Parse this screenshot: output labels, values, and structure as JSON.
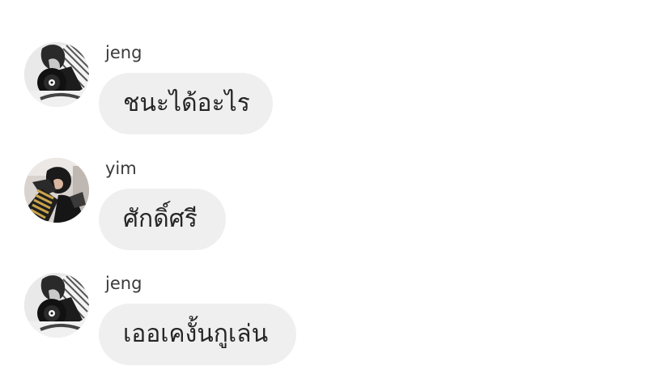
{
  "messages": [
    {
      "sender": "jeng",
      "text": "ชนะได้อะไร",
      "avatar_icon": "user-avatar-jeng"
    },
    {
      "sender": "yim",
      "text": "ศักดิ์ศรี",
      "avatar_icon": "user-avatar-yim"
    },
    {
      "sender": "jeng",
      "text": "เออเคงั้นกูเล่น",
      "avatar_icon": "user-avatar-jeng"
    }
  ],
  "colors": {
    "background": "#ffffff",
    "bubble": "#efefef",
    "sender_text": "#3a3a3a",
    "message_text": "#262626"
  }
}
